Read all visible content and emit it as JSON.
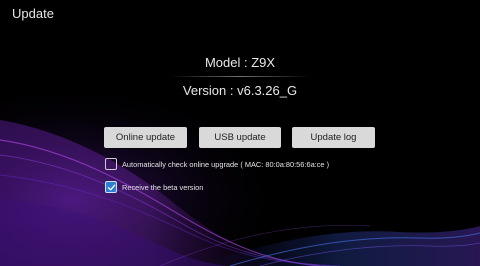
{
  "header": {
    "title": "Update"
  },
  "device": {
    "model": "Model : Z9X",
    "version": "Version : v6.3.26_G"
  },
  "buttons": {
    "online_update": "Online update",
    "usb_update": "USB update",
    "update_log": "Update log"
  },
  "options": {
    "auto_check": {
      "label": "Automatically check online upgrade ( MAC: 80:0a:80:56:6a:ce )",
      "checked": false
    },
    "beta": {
      "label": "Receive the beta version",
      "checked": true
    }
  },
  "colors": {
    "background": "#000000",
    "accent_check": "#2f7fd0",
    "button_bg": "#d9d9d9",
    "wave_purple": "#8a2fd0",
    "wave_blue": "#3a5fe8"
  },
  "icons": {
    "checkmark": "check-icon"
  }
}
